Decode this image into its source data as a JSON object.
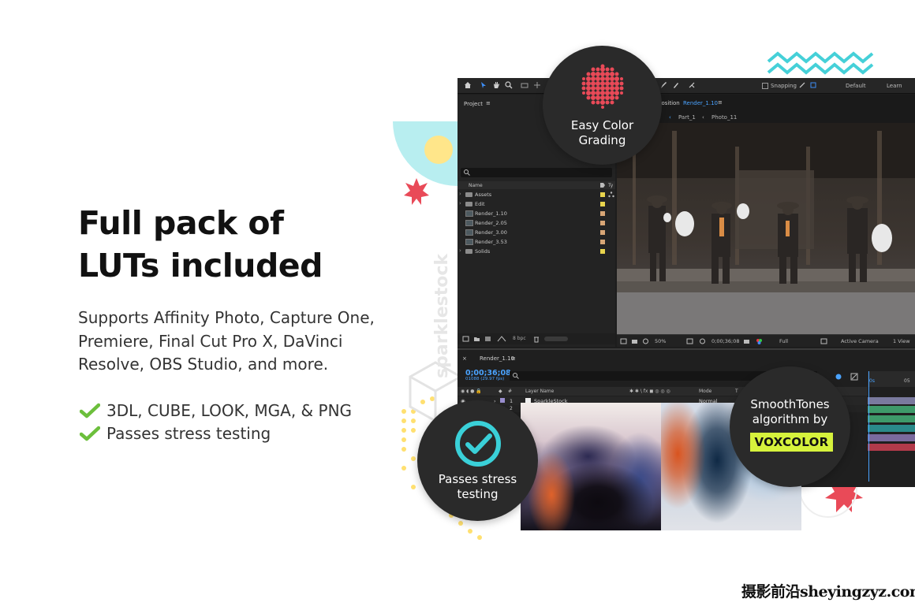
{
  "headline": {
    "line1": "Full pack of",
    "line2": "LUTs included"
  },
  "subtext": {
    "line1": "Supports Affinity Photo, Capture One,",
    "line2": "Premiere, Final Cut Pro X, DaVinci",
    "line3": "Resolve, OBS Studio, and more."
  },
  "features": [
    {
      "label": "3DL, CUBE, LOOK, MGA, & PNG",
      "icon": "check-icon"
    },
    {
      "label": "Passes stress testing",
      "icon": "check-icon"
    }
  ],
  "accent_colors": {
    "check_green": "#6cbf3c",
    "voxcolor_yellow": "#d6f23c",
    "badge_dark": "#2a2a2a",
    "timecode_blue": "#4aa3ff",
    "coral": "#e94a58"
  },
  "decor_watermark": "sparklestock",
  "editor": {
    "toolbar": {
      "snapping": "Snapping",
      "workspace": "Default",
      "learn": "Learn"
    },
    "project_panel": {
      "title": "Project",
      "column_name": "Name",
      "column_type": "Ty",
      "items": [
        {
          "name": "Assets",
          "kind": "folder",
          "label_color": "#e8d44d"
        },
        {
          "name": "Edit",
          "kind": "folder",
          "label_color": "#e8d44d"
        },
        {
          "name": "Render_1.10",
          "kind": "comp",
          "label_color": "#d8a676"
        },
        {
          "name": "Render_2.05",
          "kind": "comp",
          "label_color": "#d8a676"
        },
        {
          "name": "Render_3.00",
          "kind": "comp",
          "label_color": "#d8a676"
        },
        {
          "name": "Render_3.53",
          "kind": "comp",
          "label_color": "#d8a676"
        },
        {
          "name": "Solids",
          "kind": "folder",
          "label_color": "#e8d44d"
        }
      ],
      "bit_depth": "8 bpc"
    },
    "composition_panel": {
      "title_prefix": "position",
      "title_comp": "Render_1.10",
      "crumbs": [
        "Part_1",
        "Photo_11"
      ],
      "zoom": "50%",
      "timecode": "0;00;36;08",
      "resolution": "Full",
      "camera": "Active Camera",
      "view": "1 View"
    },
    "timeline": {
      "tab": "Render_1.10",
      "timecode": "0;00;36;08",
      "frames": "01088 (29.97 fps)",
      "col_layer_name": "Layer Name",
      "col_mode": "Mode",
      "col_t": "T",
      "layer_num": "1",
      "layer2_num": "2",
      "layer_name": "SparkleStock",
      "layer_mode": "Normal",
      "ruler_start": "0s",
      "ruler_next": "05"
    }
  },
  "badges": {
    "color_grading": {
      "line1": "Easy Color",
      "line2": "Grading"
    },
    "stress": {
      "line1": "Passes stress",
      "line2": "testing"
    },
    "smooth": {
      "line1": "SmoothTones",
      "line2": "algorithm by",
      "brand": "VOXCOLOR"
    }
  },
  "site_watermark": "摄影前沿sheyingzyz.com"
}
